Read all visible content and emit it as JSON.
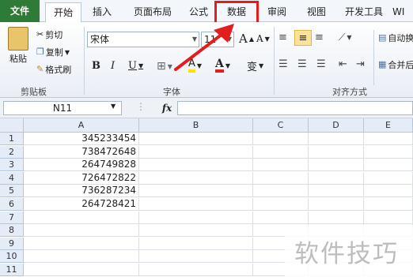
{
  "tabs": {
    "file": "文件",
    "home": "开始",
    "insert": "插入",
    "layout": "页面布局",
    "formulas": "公式",
    "data": "数据",
    "review": "审阅",
    "view": "视图",
    "developer": "开发工具",
    "more": "WI"
  },
  "clipboard": {
    "paste": "粘贴",
    "cut": "剪切",
    "copy": "复制",
    "format_painter": "格式刷",
    "label": "剪贴板"
  },
  "font": {
    "name": "宋体",
    "size": "11",
    "grow": "A",
    "shrink": "A",
    "bold": "B",
    "italic": "I",
    "underline": "U",
    "border": "⊞",
    "fill": "A",
    "color": "A",
    "phonetic": "变",
    "label": "字体"
  },
  "alignment": {
    "wrap": "自动换",
    "merge": "合并后",
    "label": "对齐方式"
  },
  "formula_bar": {
    "name_box": "N11",
    "fx": "fx",
    "content": ""
  },
  "columns": [
    "A",
    "B",
    "C",
    "D",
    "E"
  ],
  "rows": [
    "1",
    "2",
    "3",
    "4",
    "5",
    "6",
    "7",
    "8",
    "9",
    "10",
    "11"
  ],
  "cells_A": [
    "345233454",
    "738472648",
    "264749828",
    "726472822",
    "736287234",
    "264728421"
  ],
  "watermark": "软件技巧",
  "colors": {
    "file_tab": "#2e7b37",
    "highlight": "#e31c1c",
    "arrow": "#e31c1c"
  }
}
